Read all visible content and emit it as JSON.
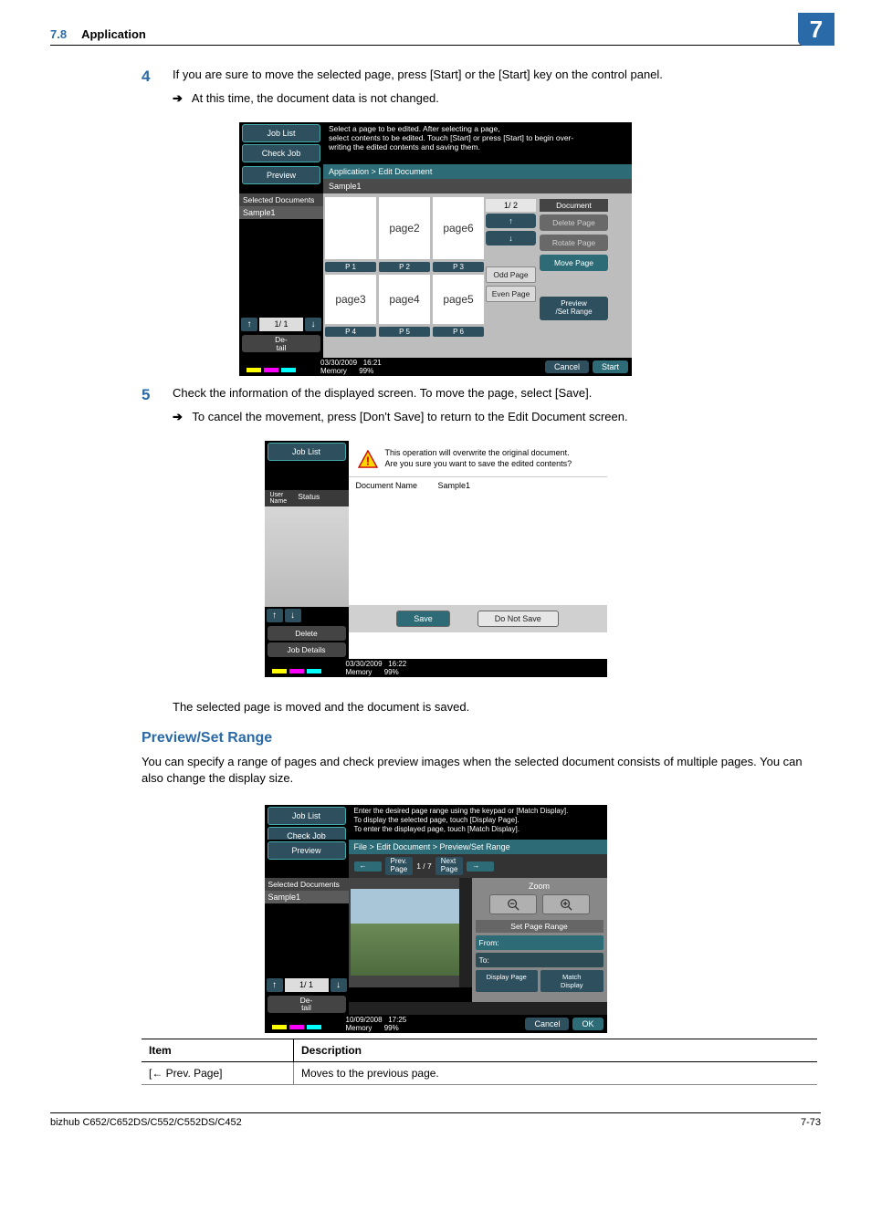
{
  "header": {
    "section_num": "7.8",
    "section_title": "Application",
    "chapter_badge": "7"
  },
  "step4": {
    "number": "4",
    "text": "If you are sure to move the selected page, press [Start] or the [Start] key on the control panel.",
    "sub": "At this time, the document data is not changed."
  },
  "screen1": {
    "side": {
      "job_list": "Job List",
      "check_job": "Check Job",
      "preview": "Preview"
    },
    "instr": "Select a page to be edited. After selecting a page,\nselect contents to be edited. Touch [Start] or press [Start] to begin over-\nwriting the edited contents and saving them.",
    "crumb": "Application > Edit Document",
    "docname": "Sample1",
    "selected_docs_head": "Selected Documents",
    "selected_doc": "Sample1",
    "pages_grid": [
      {
        "label": "",
        "p": "P   1"
      },
      {
        "label": "page2",
        "p": "P   2"
      },
      {
        "label": "page6",
        "p": "P   3"
      },
      {
        "label": "page3",
        "p": "P   4"
      },
      {
        "label": "page4",
        "p": "P   5"
      },
      {
        "label": "page5",
        "p": "P   6"
      }
    ],
    "pager_main": "1/  2",
    "odd_page": "Odd Page",
    "even_page": "Even Page",
    "right_head": "Document",
    "right_buttons": {
      "delete": "Delete Page",
      "rotate": "Rotate Page",
      "move": "Move Page",
      "preview": "Preview\n/Set Range"
    },
    "left_pager": "1/  1",
    "detail": "De-\ntail",
    "status": {
      "date": "03/30/2009",
      "time": "16:21",
      "memlbl": "Memory",
      "mempct": "99%"
    },
    "cancel": "Cancel",
    "start": "Start"
  },
  "step5": {
    "number": "5",
    "text": "Check the information of the displayed screen. To move the page, select [Save].",
    "sub": "To cancel the movement, press [Don't Save] to return to the Edit Document screen."
  },
  "screen2": {
    "side": {
      "job_list": "Job List"
    },
    "msg_line1": "This operation will overwrite the original document.",
    "msg_line2": "Are you sure you want to save the edited contents?",
    "docname_lbl": "Document Name",
    "docname_val": "Sample1",
    "user_col": "User\nName",
    "status_col": "Status",
    "delete": "Delete",
    "job_details": "Job Details",
    "save": "Save",
    "nosave": "Do Not Save",
    "status": {
      "date": "03/30/2009",
      "time": "16:22",
      "memlbl": "Memory",
      "mempct": "99%"
    }
  },
  "result_text": "The selected page is moved and the document is saved.",
  "subhead": "Preview/Set Range",
  "para": "You can specify a range of pages and check preview images when the selected document consists of multiple pages. You can also change the display size.",
  "screen3": {
    "side": {
      "job_list": "Job List",
      "check_job": "Check Job",
      "preview": "Preview"
    },
    "instr": "Enter the desired page range using the keypad or [Match Display].\nTo display the selected page, touch [Display Page].\nTo enter the displayed page, touch [Match Display].",
    "crumb": "File > Edit Document >  Preview/Set Range",
    "prev_page": "Prev.\nPage",
    "next_page": "Next\nPage",
    "page_nav": "1 /      7",
    "selected_docs_head": "Selected Documents",
    "selected_doc": "Sample1",
    "left_pager": "1/  1",
    "detail": "De-\ntail",
    "zoom_head": "Zoom",
    "range_head": "Set Page Range",
    "from": "From:",
    "to": "To:",
    "display_page": "Display Page",
    "match_display": "Match\nDisplay",
    "status": {
      "date": "10/09/2008",
      "time": "17:25",
      "memlbl": "Memory",
      "mempct": "99%"
    },
    "cancel": "Cancel",
    "ok": "OK"
  },
  "table": {
    "head_item": "Item",
    "head_desc": "Description",
    "rows": [
      {
        "item": "[← Prev. Page]",
        "desc": "Moves to the previous page."
      }
    ]
  },
  "footer": {
    "model": "bizhub C652/C652DS/C552/C552DS/C452",
    "page": "7-73"
  }
}
